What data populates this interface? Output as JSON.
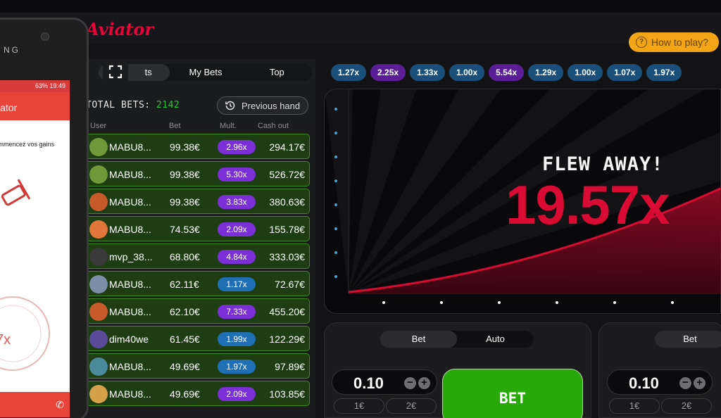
{
  "app": {
    "logo": "Aviator",
    "how_to_play": "How to play?"
  },
  "tabs": [
    {
      "label": "All Bets",
      "visible_label": "ts"
    },
    {
      "label": "My Bets"
    },
    {
      "label": "Top"
    }
  ],
  "bets_panel": {
    "total_bets_label": "TOTAL BETS:",
    "total_bets_value": "2142",
    "previous_hand": "Previous hand",
    "columns": {
      "user": "User",
      "bet": "Bet",
      "mult": "Mult.",
      "cashout": "Cash out"
    },
    "rows": [
      {
        "user": "MABU8...",
        "bet": "99.38€",
        "mult": "2.96x",
        "cashout": "294.17€",
        "mult_color": "#7b2fd6",
        "avatar_color": "#6f9a3a"
      },
      {
        "user": "MABU8...",
        "bet": "99.38€",
        "mult": "5.30x",
        "cashout": "526.72€",
        "mult_color": "#7b2fd6",
        "avatar_color": "#6f9a3a"
      },
      {
        "user": "MABU8...",
        "bet": "99.38€",
        "mult": "3.83x",
        "cashout": "380.63€",
        "mult_color": "#7b2fd6",
        "avatar_color": "#c75a2a"
      },
      {
        "user": "MABU8...",
        "bet": "74.53€",
        "mult": "2.09x",
        "cashout": "155.78€",
        "mult_color": "#7b2fd6",
        "avatar_color": "#e0763a"
      },
      {
        "user": "mvp_38...",
        "bet": "68.80€",
        "mult": "4.84x",
        "cashout": "333.03€",
        "mult_color": "#7b2fd6",
        "avatar_color": "#3a3a3a"
      },
      {
        "user": "MABU8...",
        "bet": "62.11€",
        "mult": "1.17x",
        "cashout": "72.67€",
        "mult_color": "#1f6fb5",
        "avatar_color": "#7a8fa8"
      },
      {
        "user": "MABU8...",
        "bet": "62.10€",
        "mult": "7.33x",
        "cashout": "455.20€",
        "mult_color": "#7b2fd6",
        "avatar_color": "#c75a2a"
      },
      {
        "user": "dim40we",
        "bet": "61.45€",
        "mult": "1.99x",
        "cashout": "122.29€",
        "mult_color": "#1f6fb5",
        "avatar_color": "#5a4a9a"
      },
      {
        "user": "MABU8...",
        "bet": "49.69€",
        "mult": "1.97x",
        "cashout": "97.89€",
        "mult_color": "#1f6fb5",
        "avatar_color": "#4a8a9a"
      },
      {
        "user": "MABU8...",
        "bet": "49.69€",
        "mult": "2.09x",
        "cashout": "103.85€",
        "mult_color": "#7b2fd6",
        "avatar_color": "#d4a14a"
      }
    ]
  },
  "history": [
    {
      "value": "1.27x",
      "color": "#3ba5e0"
    },
    {
      "value": "2.25x",
      "color": "#a34be8"
    },
    {
      "value": "1.33x",
      "color": "#3ba5e0"
    },
    {
      "value": "1.00x",
      "color": "#3ba5e0"
    },
    {
      "value": "5.54x",
      "color": "#a34be8"
    },
    {
      "value": "1.29x",
      "color": "#3ba5e0"
    },
    {
      "value": "1.00x",
      "color": "#3ba5e0"
    },
    {
      "value": "1.07x",
      "color": "#3ba5e0"
    },
    {
      "value": "1.97x",
      "color": "#3ba5e0"
    }
  ],
  "game": {
    "status": "FLEW AWAY!",
    "multiplier": "19.57x",
    "curve_color": "#d90b33"
  },
  "bet_controls": [
    {
      "tab_bet": "Bet",
      "tab_auto": "Auto",
      "amount": "0.10",
      "quick_1": "1€",
      "quick_2": "2€",
      "bet_button": "BET"
    },
    {
      "tab_bet": "Bet",
      "amount": "0.10",
      "quick_1": "1€",
      "quick_2": "2€"
    }
  ],
  "phone": {
    "brand": "NG",
    "status": "63% 19:49",
    "app_title": "viator",
    "message": "commencez vos gains",
    "overlay_label": "7x"
  }
}
